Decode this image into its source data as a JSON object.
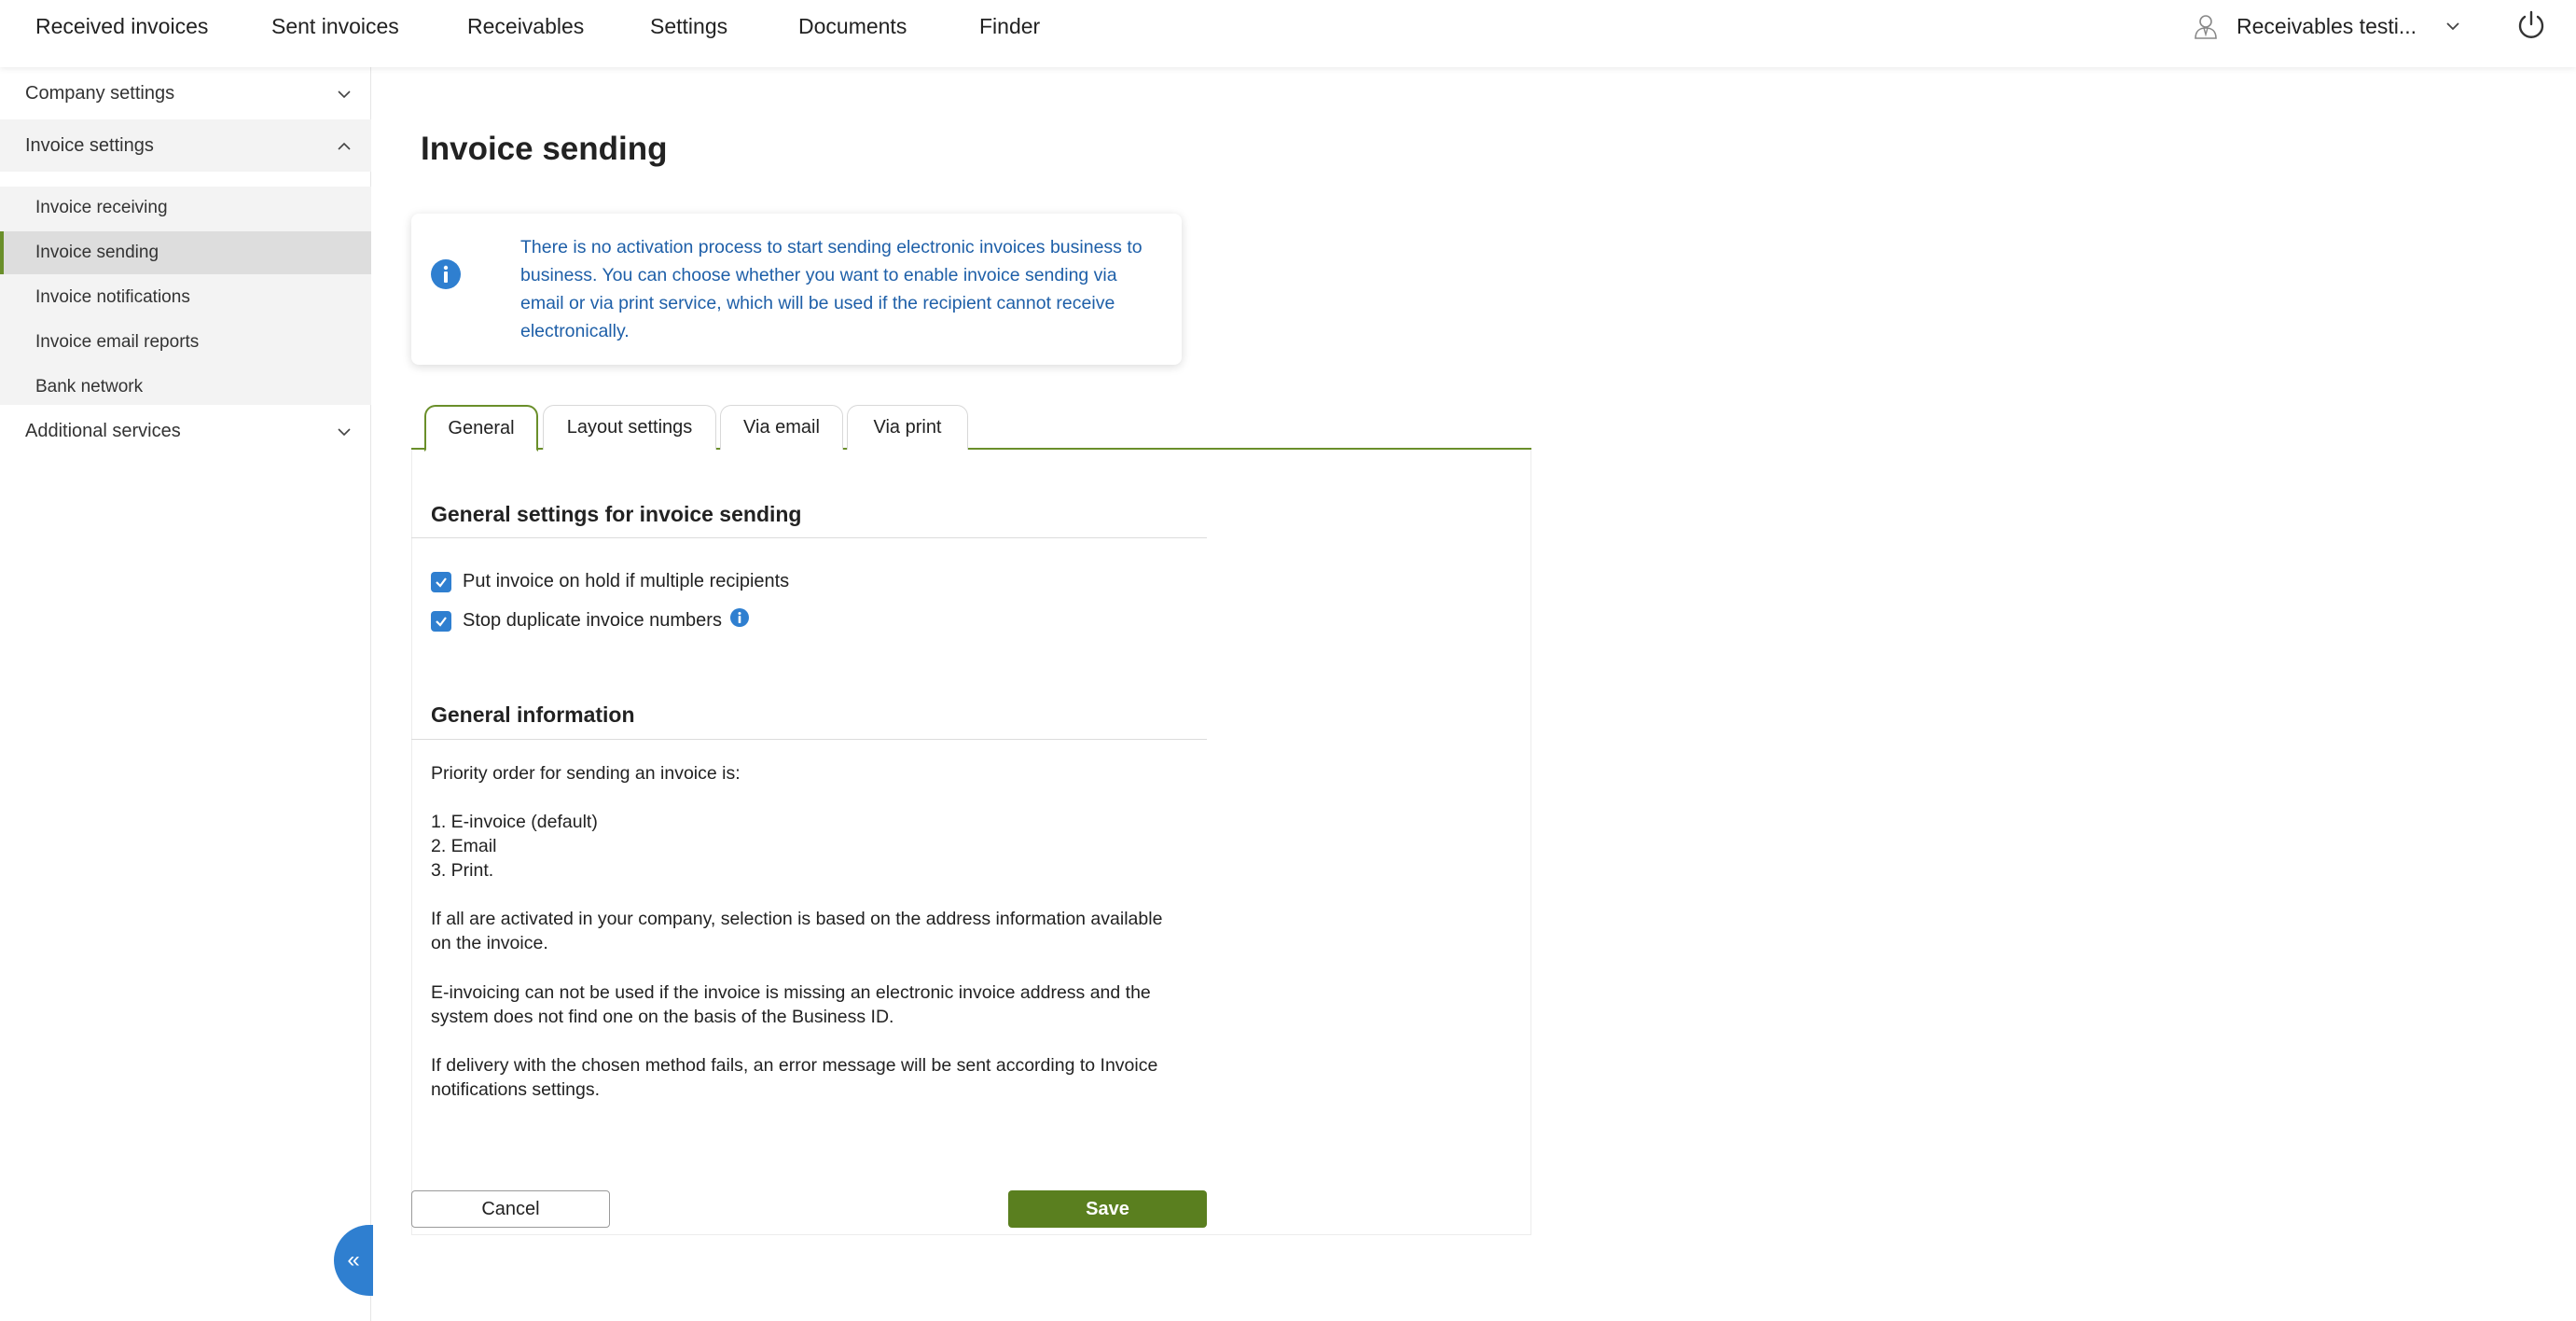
{
  "nav": {
    "items": [
      "Received invoices",
      "Sent invoices",
      "Receivables",
      "Settings",
      "Documents",
      "Finder"
    ],
    "user_name": "Receivables testi..."
  },
  "sidebar": {
    "company_settings": "Company settings",
    "invoice_settings": "Invoice settings",
    "sub_items": [
      "Invoice receiving",
      "Invoice sending",
      "Invoice notifications",
      "Invoice email reports",
      "Bank network"
    ],
    "additional_services": "Additional services",
    "collapse_glyph": "«"
  },
  "main": {
    "title": "Invoice sending",
    "info_text": "There is no activation process to start sending electronic invoices business to business. You can choose whether you want to enable invoice sending via email or via print service, which will be used if the recipient cannot receive electronically.",
    "tabs": [
      "General",
      "Layout settings",
      "Via email",
      "Via print"
    ],
    "general_settings_title": "General settings for invoice sending",
    "checkboxes": [
      {
        "label": "Put invoice on hold if multiple recipients",
        "checked": true
      },
      {
        "label": "Stop duplicate invoice numbers",
        "checked": true
      }
    ],
    "general_info_title": "General information",
    "priority_intro": "Priority order for sending an invoice is:",
    "priority_list": [
      "1. E-invoice (default)",
      "2. Email",
      "3. Print."
    ],
    "para1": "If all are activated in your company, selection is based on the address information available on the invoice.",
    "para2": "E-invoicing can not be used if the invoice is missing an electronic invoice address and the system does not find one on the basis of the Business ID.",
    "para3": "If delivery with the chosen method fails, an error message will be sent according to Invoice notifications settings.",
    "cancel_label": "Cancel",
    "save_label": "Save"
  },
  "colors": {
    "accent_green": "#6a8f2a",
    "save_green": "#5a7f1f",
    "info_blue": "#1e5fa8",
    "checkbox_blue": "#2f7fd0"
  }
}
